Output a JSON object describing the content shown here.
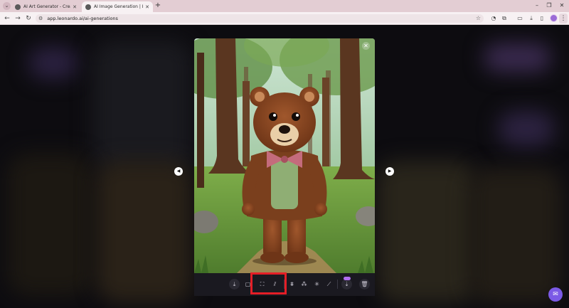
{
  "browser": {
    "tabs": [
      {
        "title": "AI Art Generator - Create Art..."
      },
      {
        "title": "AI Image Generation | Leonar..."
      }
    ],
    "url": "app.leonardo.ai/ai-generations"
  },
  "icons": {
    "tab_search": "chevron-down-icon",
    "close": "close-icon",
    "new_tab": "plus-icon",
    "back": "arrow-left-icon",
    "forward": "arrow-right-icon",
    "reload": "reload-icon",
    "bookmark": "star-icon",
    "download": "download-icon",
    "delete": "trash-icon"
  },
  "colors": {
    "highlight": "#e41e26",
    "accent": "#7b5ae6",
    "tabbar": "#e3cdd3"
  }
}
